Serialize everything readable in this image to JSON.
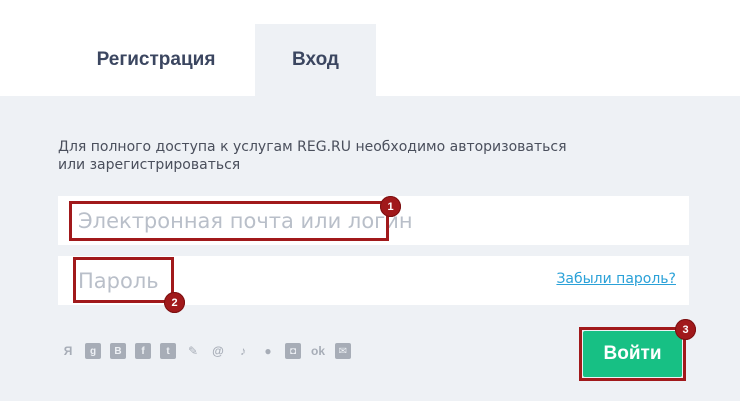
{
  "tabs": {
    "register_label": "Регистрация",
    "login_label": "Вход"
  },
  "intro_text": "Для полного доступа к услугам REG.RU необходимо авторизоваться или зарегистрироваться",
  "form": {
    "email_placeholder": "Электронная почта или логин",
    "password_placeholder": "Пароль",
    "forgot_label": "Забыли пароль?",
    "submit_label": "Войти"
  },
  "annotations": {
    "badge_1": "1",
    "badge_2": "2",
    "badge_3": "3"
  },
  "social_icons": [
    {
      "name": "yandex-icon",
      "glyph": "Я"
    },
    {
      "name": "google-icon",
      "glyph": "g"
    },
    {
      "name": "vk-icon",
      "glyph": "В"
    },
    {
      "name": "facebook-icon",
      "glyph": "f"
    },
    {
      "name": "twitter-icon",
      "glyph": "t"
    },
    {
      "name": "livejournal-icon",
      "glyph": "✎"
    },
    {
      "name": "mail-ru-icon",
      "glyph": "@"
    },
    {
      "name": "tiktok-icon",
      "glyph": "♪"
    },
    {
      "name": "github-icon",
      "glyph": "●"
    },
    {
      "name": "instagram-icon",
      "glyph": "◘"
    },
    {
      "name": "odnoklassniki-icon",
      "glyph": "ok"
    },
    {
      "name": "gosuslugi-icon",
      "glyph": "✉"
    }
  ],
  "colors": {
    "panel_bg": "#eef1f5",
    "accent_green": "#17c084",
    "link_blue": "#2aa1d8",
    "highlight_red": "#a1191b",
    "heading_text": "#3b4660"
  }
}
